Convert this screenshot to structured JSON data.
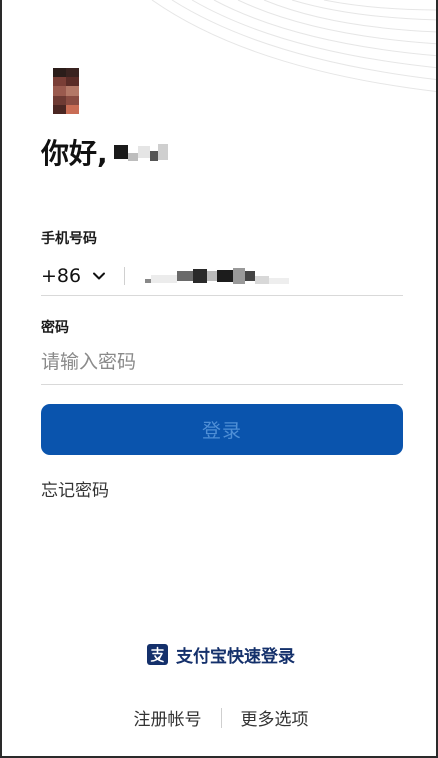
{
  "header": {
    "greeting_prefix": "你好,"
  },
  "phone": {
    "label": "手机号码",
    "country_code": "+86"
  },
  "password": {
    "label": "密码",
    "placeholder": "请输入密码"
  },
  "actions": {
    "login_label": "登录",
    "forgot_label": "忘记密码",
    "alipay_label": "支付宝快速登录"
  },
  "footer": {
    "register_label": "注册帐号",
    "more_label": "更多选项"
  },
  "colors": {
    "primary_button": "#0a54ad",
    "alipay_blue": "#14306b"
  },
  "icons": {
    "country_dropdown": "chevron-down-icon",
    "alipay": "alipay-icon"
  }
}
